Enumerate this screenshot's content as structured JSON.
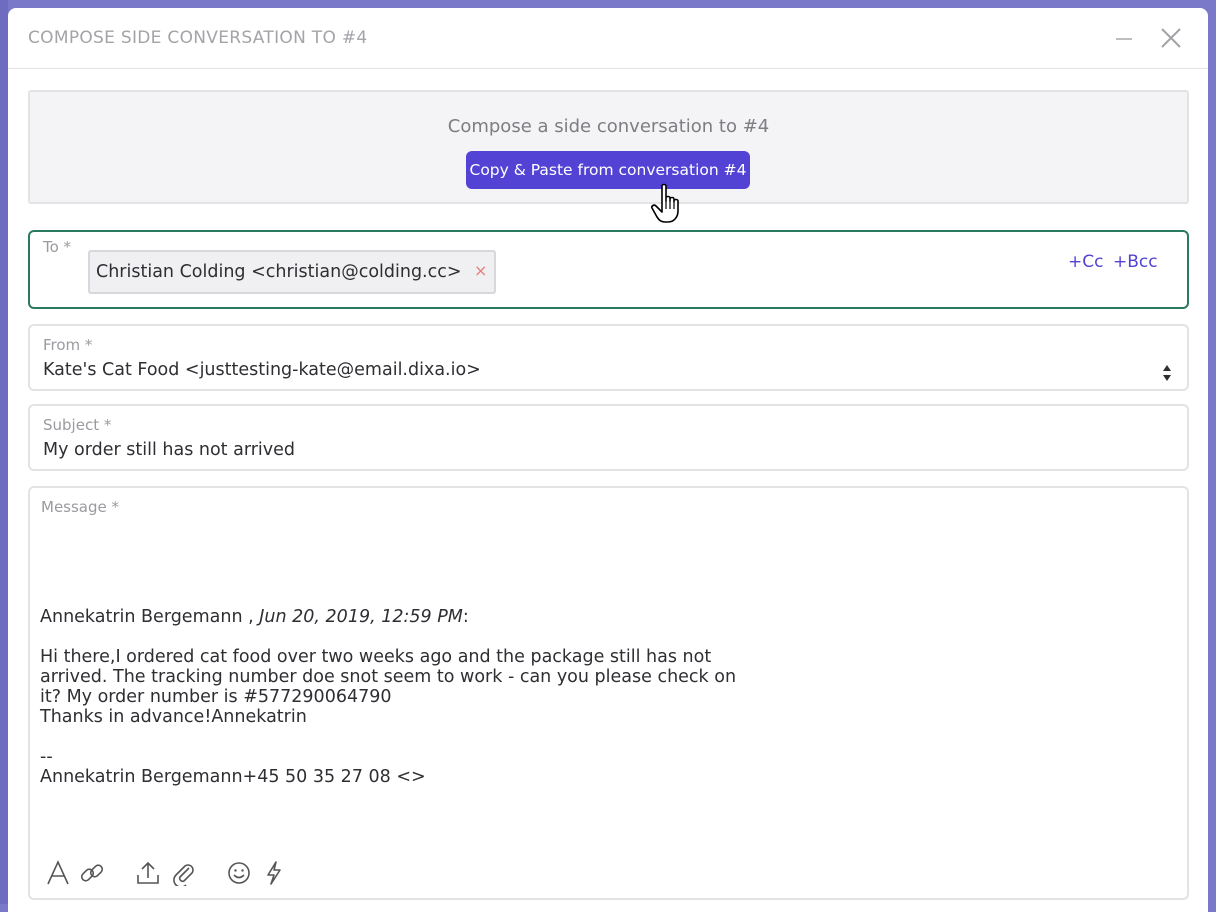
{
  "modal": {
    "title": "COMPOSE SIDE CONVERSATION TO #4",
    "minimize_icon": "minimize-icon",
    "close_icon": "close-icon"
  },
  "prefill": {
    "title": "Compose a side conversation to #4",
    "button_label": "Copy & Paste from conversation #4"
  },
  "to": {
    "label": "To *",
    "recipient": "Christian Colding <christian@colding.cc>",
    "remove_glyph": "×",
    "cc_label": "+Cc",
    "bcc_label": "+Bcc"
  },
  "from": {
    "label": "From *",
    "value": "Kate's Cat Food <justtesting-kate@email.dixa.io>"
  },
  "subject": {
    "label": "Subject *",
    "value": "My order still has not arrived"
  },
  "message": {
    "label": "Message *",
    "author": "Annekatrin Bergemann ,",
    "date": "Jun 20, 2019, 12:59 PM",
    "date_suffix": ":",
    "lines": [
      "Hi there,I ordered cat food over two weeks ago and the package still has not",
      "arrived. The tracking number doe snot seem to work - can you please check on",
      "it? My order number is #577290064790",
      "Thanks in advance!Annekatrin"
    ],
    "signature_sep": "--",
    "signature": "Annekatrin Bergemann+45 50 35 27 08 <>"
  },
  "toolbar": {
    "icons": [
      "text-format-icon",
      "link-icon",
      "upload-icon",
      "attachment-icon",
      "emoji-icon",
      "lightning-icon"
    ]
  },
  "colors": {
    "accent": "#5243d4",
    "focus_border": "#2b7a5e",
    "remove_red": "#e2807a",
    "backdrop": "#7a78c8"
  }
}
